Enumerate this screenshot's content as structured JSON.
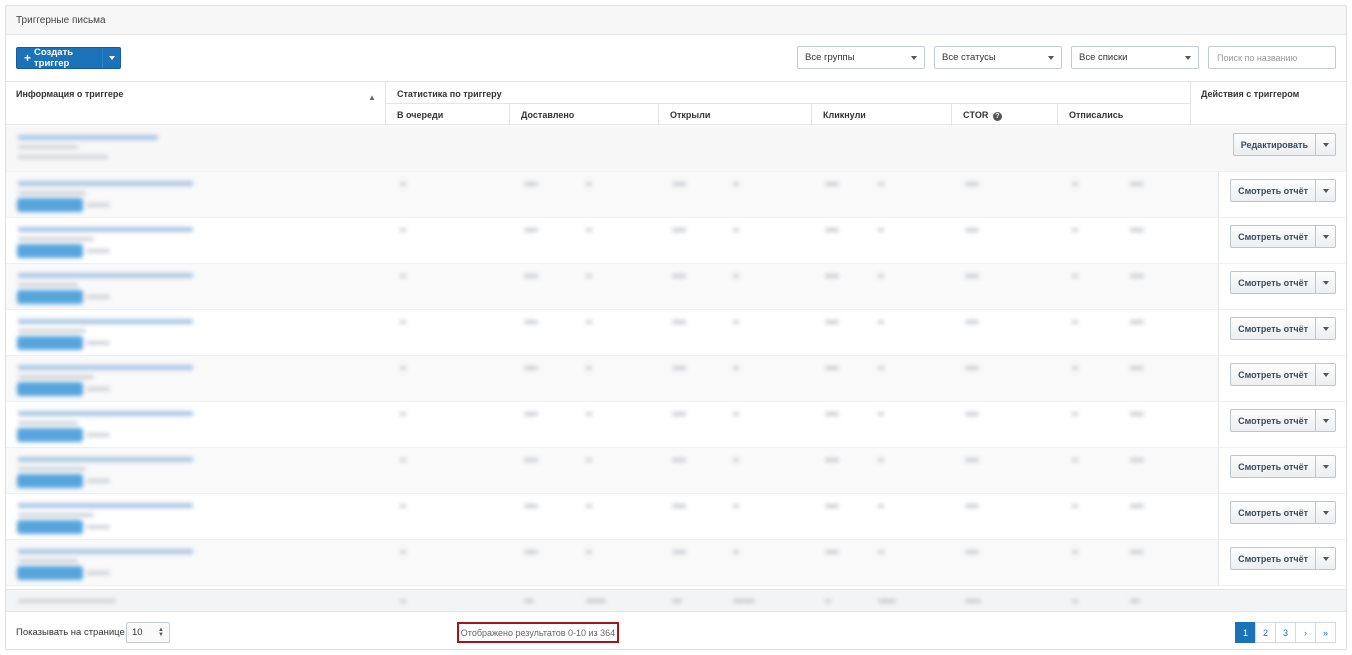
{
  "panel": {
    "title": "Триггерные письма"
  },
  "toolbar": {
    "create_label": "Создать триггер",
    "filters": [
      "Все группы",
      "Все статусы",
      "Все списки"
    ],
    "search_placeholder": "Поиск по названию"
  },
  "table": {
    "col_info": "Информация о триггере",
    "col_stats_group": "Статистика по триггеру",
    "col_actions": "Действия с триггером",
    "stat_columns": [
      "В очереди",
      "Доставлено",
      "Открыли",
      "Кликнули",
      "CTOR",
      "Отписались"
    ],
    "rows": [
      {
        "action": "Редактировать"
      },
      {
        "action": "Смотреть отчёт"
      },
      {
        "action": "Смотреть отчёт"
      },
      {
        "action": "Смотреть отчёт"
      },
      {
        "action": "Смотреть отчёт"
      },
      {
        "action": "Смотреть отчёт"
      },
      {
        "action": "Смотреть отчёт"
      },
      {
        "action": "Смотреть отчёт"
      },
      {
        "action": "Смотреть отчёт"
      },
      {
        "action": "Смотреть отчёт"
      }
    ]
  },
  "footer": {
    "per_page_label": "Показывать на странице",
    "per_page_value": "10",
    "results_text": "Отображено результатов 0-10 из 364",
    "pages": [
      "1",
      "2",
      "3"
    ],
    "next": "›",
    "last": "»"
  },
  "colors": {
    "accent": "#1b72b8",
    "highlight_border": "#a8121b"
  },
  "icons": {
    "sort": "sort-arrows-icon",
    "help": "question-circle-icon",
    "plus": "plus-icon"
  }
}
